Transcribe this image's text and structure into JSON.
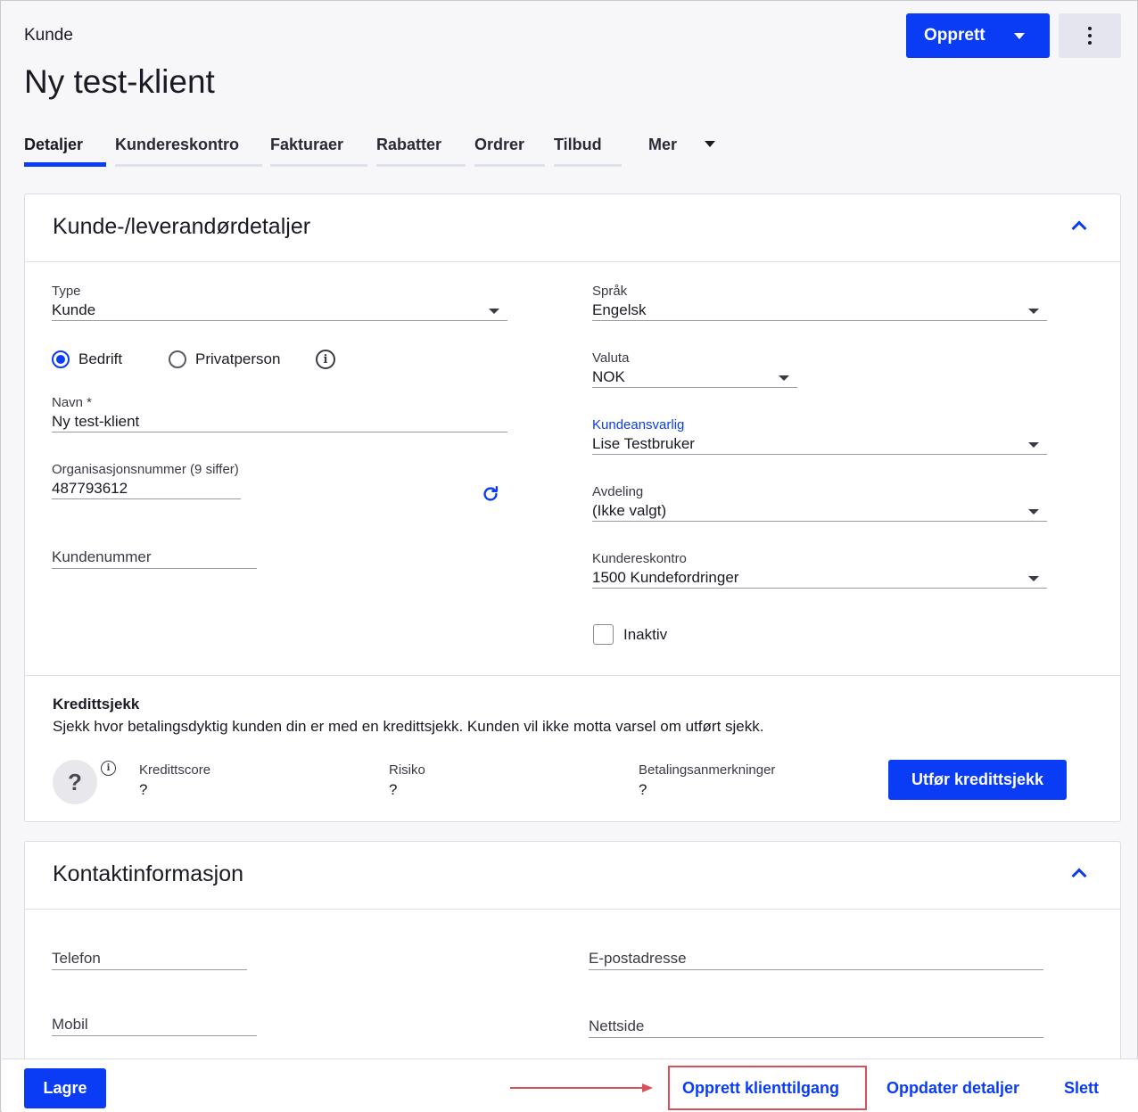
{
  "header": {
    "breadcrumb": "Kunde",
    "title": "Ny test-klient",
    "create_label": "Opprett"
  },
  "tabs": [
    {
      "label": "Detaljer",
      "active": true
    },
    {
      "label": "Kundereskontro"
    },
    {
      "label": "Fakturaer"
    },
    {
      "label": "Rabatter"
    },
    {
      "label": "Ordrer"
    },
    {
      "label": "Tilbud"
    },
    {
      "label": "Mer"
    }
  ],
  "details": {
    "title": "Kunde-/leverandørdetaljer",
    "type": {
      "label": "Type",
      "value": "Kunde"
    },
    "radio": {
      "company": "Bedrift",
      "private": "Privatperson",
      "selected": "Bedrift"
    },
    "name": {
      "label": "Navn *",
      "value": "Ny test-klient"
    },
    "orgnr": {
      "label": "Organisasjonsnummer (9 siffer)",
      "value": "487793612"
    },
    "customer_number": {
      "placeholder": "Kundenummer"
    },
    "language": {
      "label": "Språk",
      "value": "Engelsk"
    },
    "currency": {
      "label": "Valuta",
      "value": "NOK"
    },
    "account_manager": {
      "label": "Kundeansvarlig",
      "value": "Lise Testbruker"
    },
    "department": {
      "label": "Avdeling",
      "value": "(Ikke valgt)"
    },
    "ledger": {
      "label": "Kundereskontro",
      "value": "1500 Kundefordringer"
    },
    "inactive_label": "Inaktiv"
  },
  "credit_check": {
    "title": "Kredittsjekk",
    "description": "Sjekk hvor betalingsdyktig kunden din er med en kredittsjekk. Kunden vil ikke motta varsel om utført sjekk.",
    "unknown_glyph": "?",
    "score": {
      "label": "Kredittscore",
      "value": "?"
    },
    "risk": {
      "label": "Risiko",
      "value": "?"
    },
    "remarks": {
      "label": "Betalingsanmerkninger",
      "value": "?"
    },
    "button_label": "Utfør kredittsjekk"
  },
  "contact": {
    "title": "Kontaktinformasjon",
    "phone": "Telefon",
    "email": "E-postadresse",
    "mobile": "Mobil",
    "website": "Nettside"
  },
  "footer": {
    "save_label": "Lagre",
    "client_access_label": "Opprett klienttilgang",
    "update_label": "Oppdater detaljer",
    "delete_label": "Slett"
  },
  "colors": {
    "accent": "#0a3cf5",
    "highlight": "#d9505a"
  }
}
